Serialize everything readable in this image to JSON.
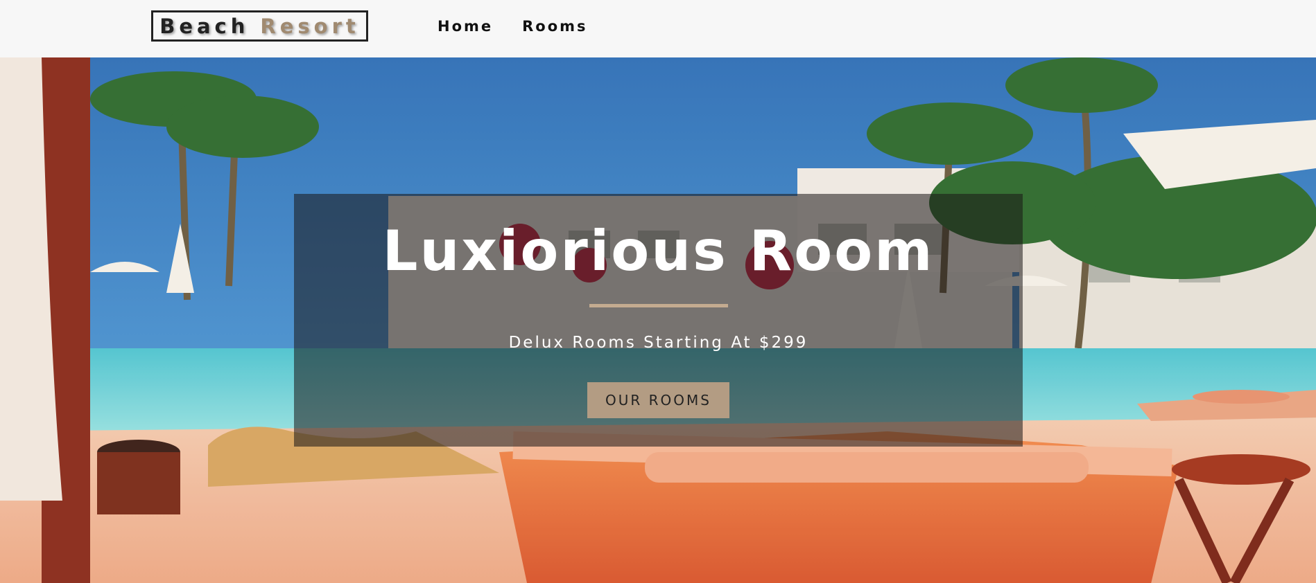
{
  "nav": {
    "logo_word1": "Beach",
    "logo_word2": "Resort",
    "links": [
      "Home",
      "Rooms"
    ]
  },
  "hero": {
    "title": "Luxiorious Room",
    "subtitle": "Delux Rooms Starting At $299",
    "button_label": "OUR ROOMS"
  },
  "colors": {
    "accent": "#b39c83",
    "navbar_bg": "#f7f7f7",
    "logo_border": "#222222"
  }
}
